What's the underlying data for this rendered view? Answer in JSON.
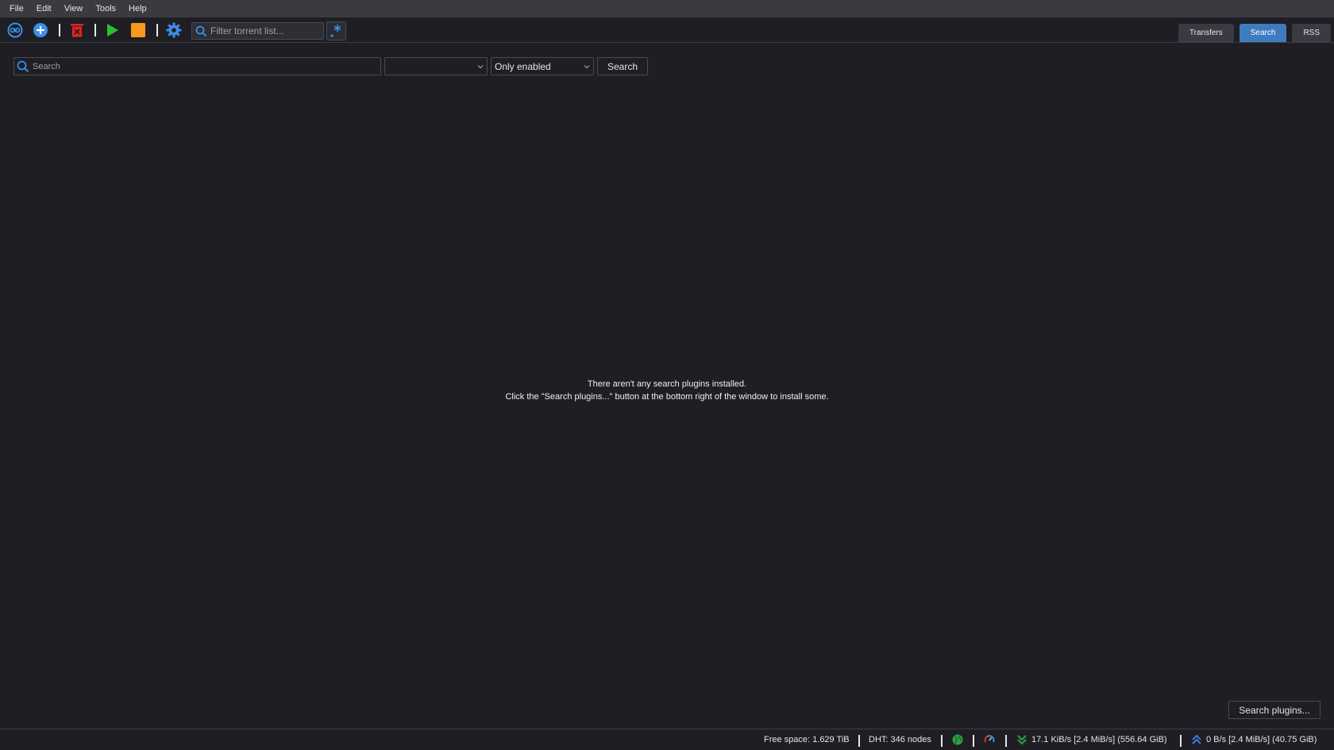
{
  "menubar": {
    "items": [
      "File",
      "Edit",
      "View",
      "Tools",
      "Help"
    ]
  },
  "toolbar": {
    "filter_placeholder": "Filter torrent list...",
    "icons": [
      "add-link-icon",
      "add-torrent-icon",
      "delete-icon",
      "resume-icon",
      "stop-icon",
      "settings-icon",
      "search-icon",
      "regex-icon"
    ]
  },
  "tabs": {
    "transfers": "Transfers",
    "search": "Search",
    "rss": "RSS",
    "active": "Search",
    "active_color": "#3f7bbf"
  },
  "search": {
    "placeholder": "Search",
    "category_value": "",
    "plugins_filter_value": "Only enabled",
    "search_button": "Search"
  },
  "empty_state": {
    "line1": "There aren't any search plugins installed.",
    "line2": "Click the \"Search plugins...\" button at the bottom right of the window to install some."
  },
  "plugins_button": "Search plugins...",
  "status": {
    "free_space": "Free space: 1.629 TiB",
    "dht": "DHT: 346 nodes",
    "download": "17.1 KiB/s [2.4 MiB/s] (556.64 GiB)",
    "upload": "0 B/s [2.4 MiB/s] (40.75 GiB)",
    "connection_color": "#2ea043",
    "download_color": "#2ea043",
    "upload_color": "#3f7bdf"
  }
}
